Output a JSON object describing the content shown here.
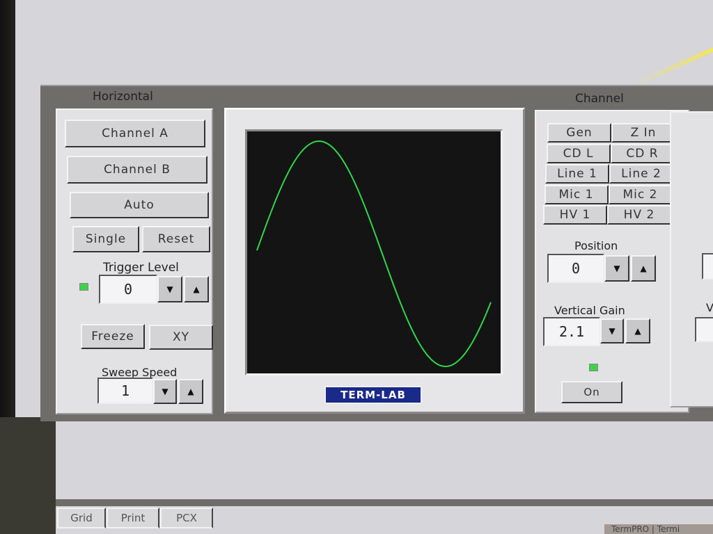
{
  "horizontal": {
    "title": "Horizontal",
    "channel_a": "Channel A",
    "channel_b": "Channel B",
    "auto": "Auto",
    "single": "Single",
    "reset": "Reset",
    "trigger_level_label": "Trigger Level",
    "trigger_level_value": "0",
    "freeze": "Freeze",
    "xy": "XY",
    "sweep_speed_label": "Sweep Speed",
    "sweep_speed_value": "1"
  },
  "scope": {
    "logo": "TERM-LAB",
    "trace_color": "#2ed84a"
  },
  "channel": {
    "title": "Channel",
    "inputs": [
      "Gen",
      "Z In",
      "CD L",
      "CD R",
      "Line 1",
      "Line 2",
      "Mic 1",
      "Mic 2",
      "HV 1",
      "HV 2"
    ],
    "position_label": "Position",
    "position_value": "0",
    "vertical_gain_label": "Vertical Gain",
    "vertical_gain_value": "2.1",
    "on": "On"
  },
  "right_panel": {
    "partial_label": "V"
  },
  "bottom_tabs": [
    "Grid",
    "Print",
    "PCX"
  ],
  "taskbar": {
    "item": "TermPRO | Termi"
  }
}
